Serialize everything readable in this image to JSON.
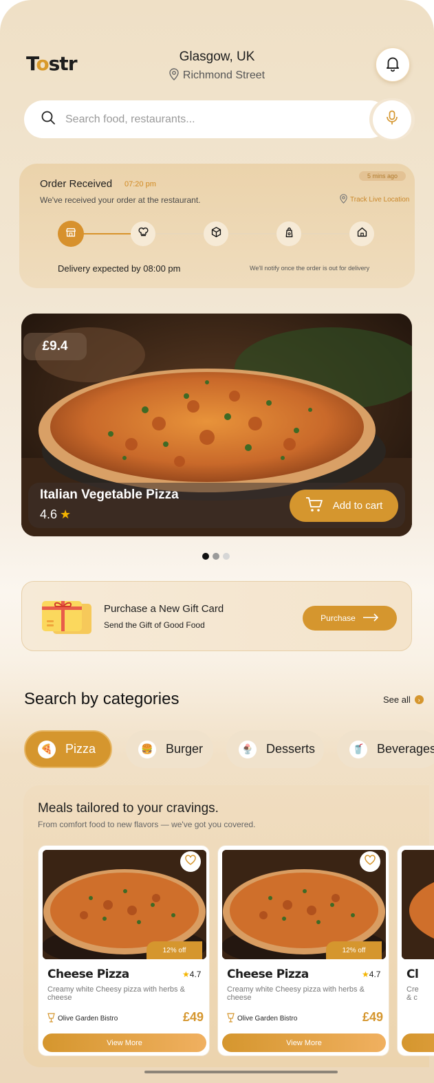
{
  "brand": {
    "logo_prefix": "T",
    "logo_o": "o",
    "logo_suffix": "str",
    "accent": "#d5962e"
  },
  "location": {
    "city": "Glasgow, UK",
    "street": "Richmond Street"
  },
  "search": {
    "placeholder": "Search food, restaurants..."
  },
  "order": {
    "title": "Order Received",
    "time": "07:20 pm",
    "subtitle": "We've received your order at the restaurant.",
    "ago": "5 mins ago",
    "track_label": "Track Live Location",
    "eta": "Delivery expected by 08:00 pm",
    "notify": "We'll notify once the order is out for delivery",
    "steps": [
      "store-icon",
      "chef-hat-icon",
      "package-icon",
      "courier-bag-icon",
      "home-icon"
    ],
    "active_step": 1
  },
  "hero": {
    "price": "£9.4",
    "name": "Italian Vegetable Pizza",
    "rating": "4.6",
    "add_to_cart": "Add to cart"
  },
  "carousel": {
    "count": 3,
    "active": 1
  },
  "gift": {
    "title": "Purchase a New Gift Card",
    "subtitle": "Send the Gift of Good Food",
    "button": "Purchase"
  },
  "categories": {
    "title": "Search by categories",
    "see_all": "See all",
    "items": [
      {
        "label": "Pizza",
        "icon": "🍕",
        "active": true
      },
      {
        "label": "Burger",
        "icon": "🍔",
        "active": false
      },
      {
        "label": "Desserts",
        "icon": "🍨",
        "active": false
      },
      {
        "label": "Beverages",
        "icon": "🥤",
        "active": false
      }
    ]
  },
  "meals": {
    "title": "Meals tailored to your cravings.",
    "subtitle": "From comfort food to new flavors — we've got you covered.",
    "cards": [
      {
        "name": "Cheese Pizza",
        "rating": "4.7",
        "discount": "12% off",
        "desc": "Creamy white Cheesy pizza with herbs & cheese",
        "restaurant": "Olive Garden Bistro",
        "price": "£49",
        "button": "View More"
      },
      {
        "name": "Cheese Pizza",
        "rating": "4.7",
        "discount": "12% off",
        "desc": "Creamy white Cheesy pizza with herbs & cheese",
        "restaurant": "Olive Garden Bistro",
        "price": "£49",
        "button": "View More"
      },
      {
        "name": "Cl",
        "rating": "",
        "discount": "",
        "desc": "Cre & c",
        "restaurant": "",
        "price": "",
        "button": ""
      }
    ]
  }
}
